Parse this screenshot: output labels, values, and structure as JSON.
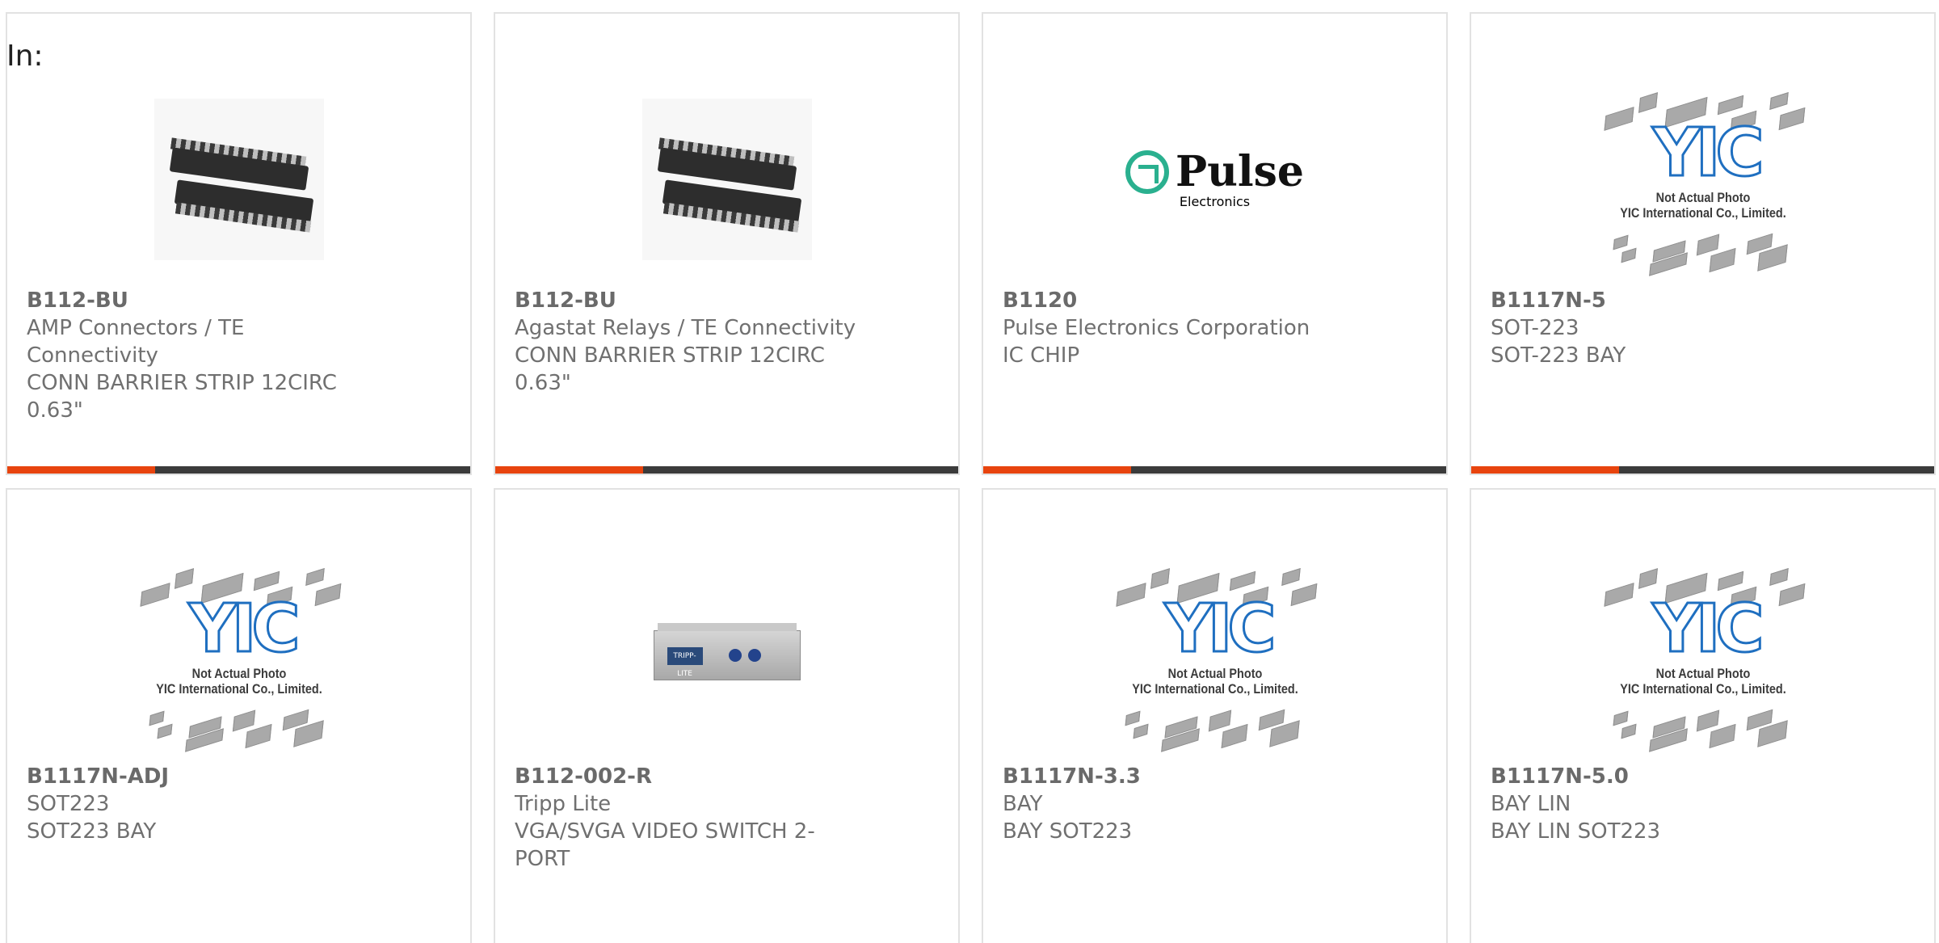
{
  "header": {
    "in_label": "In:"
  },
  "products": [
    {
      "part_number": "B112-BU",
      "manufacturer": "AMP Connectors / TE Connectivity",
      "description": "CONN BARRIER STRIP 12CIRC 0.63\"",
      "image": "barrier-strip-photo"
    },
    {
      "part_number": "B112-BU",
      "manufacturer": "Agastat Relays / TE Connectivity",
      "description": "CONN BARRIER STRIP 12CIRC 0.63\"",
      "image": "barrier-strip-photo"
    },
    {
      "part_number": "B1120",
      "manufacturer": "Pulse Electronics Corporation",
      "description": "IC CHIP",
      "image": "pulse-electronics-logo"
    },
    {
      "part_number": "B1117N-5",
      "manufacturer": "SOT-223",
      "description": "SOT-223 BAY",
      "image": "not-actual-photo-placeholder"
    },
    {
      "part_number": "B1117N-ADJ",
      "manufacturer": "SOT223",
      "description": "SOT223 BAY",
      "image": "not-actual-photo-placeholder"
    },
    {
      "part_number": "B112-002-R",
      "manufacturer": "Tripp Lite",
      "description": "VGA/SVGA VIDEO SWITCH 2-PORT",
      "image": "video-switch-photo"
    },
    {
      "part_number": "B1117N-3.3",
      "manufacturer": "BAY",
      "description": "BAY SOT223",
      "image": "not-actual-photo-placeholder"
    },
    {
      "part_number": "B1117N-5.0",
      "manufacturer": "BAY LIN",
      "description": "BAY LIN SOT223",
      "image": "not-actual-photo-placeholder"
    }
  ],
  "placeholder_image": {
    "logo_text": "YIC",
    "caption_line1": "Not Actual Photo",
    "caption_line2": "YIC International Co., Limited."
  },
  "pulse_logo": {
    "word": "Pulse",
    "sub": "Electronics"
  },
  "video_switch_label": "TRIPP-LITE",
  "colors": {
    "accent": "#e8440e",
    "bar_dark": "#3b3b3b",
    "text": "#707070",
    "card_border": "#e2e2e2",
    "yic_blue": "#1f6fc0",
    "pulse_green": "#2ab08f"
  },
  "card_accent_progress": 0.32
}
